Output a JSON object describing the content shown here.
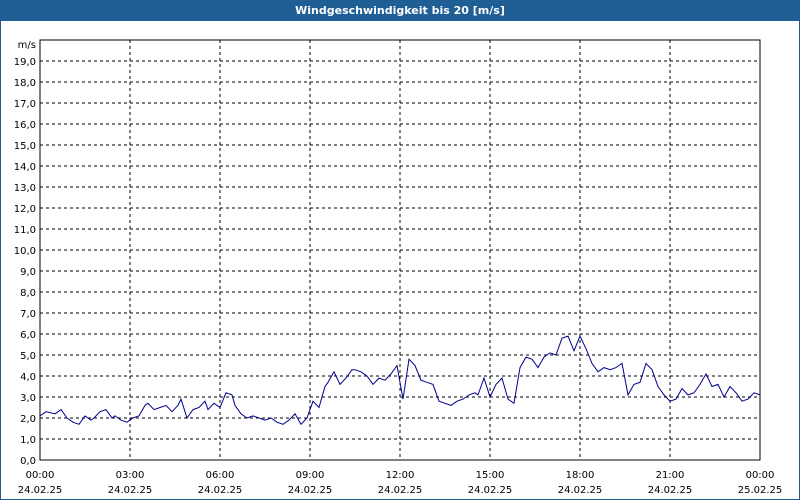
{
  "window": {
    "title": "Windgeschwindigkeit bis 20 [m/s]"
  },
  "chart_data": {
    "type": "line",
    "title": "Windgeschwindigkeit bis 20 [m/s]",
    "ylabel": "m/s",
    "xlabel": "",
    "ylim": [
      0,
      20
    ],
    "grid": true,
    "line_color": "#00008b",
    "y_ticks": [
      "0,0",
      "1,0",
      "2,0",
      "3,0",
      "4,0",
      "5,0",
      "6,0",
      "7,0",
      "8,0",
      "9,0",
      "10,0",
      "11,0",
      "12,0",
      "13,0",
      "14,0",
      "15,0",
      "16,0",
      "17,0",
      "18,0",
      "19,0"
    ],
    "x_ticks": [
      {
        "time": "00:00",
        "date": "24.02.25"
      },
      {
        "time": "03:00",
        "date": "24.02.25"
      },
      {
        "time": "06:00",
        "date": "24.02.25"
      },
      {
        "time": "09:00",
        "date": "24.02.25"
      },
      {
        "time": "12:00",
        "date": "24.02.25"
      },
      {
        "time": "15:00",
        "date": "24.02.25"
      },
      {
        "time": "18:00",
        "date": "24.02.25"
      },
      {
        "time": "21:00",
        "date": "24.02.25"
      },
      {
        "time": "00:00",
        "date": "25.02.25"
      }
    ],
    "x_range_hours": [
      0,
      24
    ],
    "series": [
      {
        "x": [
          0.0,
          0.2,
          0.5,
          0.7,
          0.9,
          1.1,
          1.3,
          1.5,
          1.7,
          1.8,
          2.0,
          2.2,
          2.4,
          2.5,
          2.7,
          2.9,
          3.1,
          3.3,
          3.5,
          3.6,
          3.8,
          4.0,
          4.2,
          4.4,
          4.6,
          4.7,
          4.9,
          5.1,
          5.3,
          5.5,
          5.6,
          5.8,
          6.0,
          6.2,
          6.4,
          6.5,
          6.7,
          6.9,
          7.1,
          7.3,
          7.5,
          7.7,
          7.9,
          8.1,
          8.3,
          8.5,
          8.7,
          8.9,
          9.1,
          9.3,
          9.5,
          9.6,
          9.8,
          10.0,
          10.2,
          10.4,
          10.5,
          10.7,
          10.9,
          11.1,
          11.3,
          11.5,
          11.7,
          11.9,
          12.1,
          12.3,
          12.5,
          12.7,
          12.9,
          13.1,
          13.3,
          13.5,
          13.7,
          13.9,
          14.1,
          14.3,
          14.5,
          14.6,
          14.8,
          15.0,
          15.2,
          15.4,
          15.6,
          15.8,
          16.0,
          16.2,
          16.4,
          16.6,
          16.8,
          17.0,
          17.2,
          17.4,
          17.6,
          17.8,
          18.0,
          18.2,
          18.4,
          18.6,
          18.8,
          19.0,
          19.2,
          19.4,
          19.6,
          19.8,
          20.0,
          20.2,
          20.4,
          20.6,
          20.8,
          21.0,
          21.2,
          21.4,
          21.6,
          21.8,
          22.0,
          22.2,
          22.4,
          22.6,
          22.8,
          23.0,
          23.2,
          23.4,
          23.6,
          23.8,
          24.0
        ],
        "values": [
          2.1,
          2.3,
          2.2,
          2.4,
          2.0,
          1.8,
          1.7,
          2.1,
          1.9,
          2.0,
          2.3,
          2.4,
          2.0,
          2.1,
          1.9,
          1.8,
          2.0,
          2.1,
          2.6,
          2.7,
          2.4,
          2.5,
          2.6,
          2.3,
          2.6,
          2.9,
          2.0,
          2.4,
          2.5,
          2.8,
          2.4,
          2.7,
          2.5,
          3.2,
          3.1,
          2.6,
          2.2,
          2.0,
          2.1,
          2.0,
          1.9,
          2.0,
          1.8,
          1.7,
          1.9,
          2.2,
          1.7,
          2.0,
          2.8,
          2.5,
          3.5,
          3.7,
          4.2,
          3.6,
          3.9,
          4.3,
          4.3,
          4.2,
          4.0,
          3.6,
          3.9,
          3.8,
          4.1,
          4.5,
          2.9,
          4.8,
          4.5,
          3.8,
          3.7,
          3.6,
          2.8,
          2.7,
          2.6,
          2.8,
          2.9,
          3.1,
          3.2,
          3.1,
          3.9,
          3.0,
          3.6,
          3.9,
          2.9,
          2.7,
          4.4,
          4.9,
          4.8,
          4.4,
          4.9,
          5.1,
          5.0,
          5.8,
          5.9,
          5.2,
          5.9,
          5.3,
          4.6,
          4.2,
          4.4,
          4.3,
          4.4,
          4.6,
          3.1,
          3.6,
          3.7,
          4.6,
          4.3,
          3.5,
          3.1,
          2.8,
          2.9,
          3.4,
          3.1,
          3.2,
          3.6,
          4.1,
          3.5,
          3.6,
          3.0,
          3.5,
          3.2,
          2.8,
          2.9,
          3.2,
          3.1
        ]
      }
    ]
  }
}
